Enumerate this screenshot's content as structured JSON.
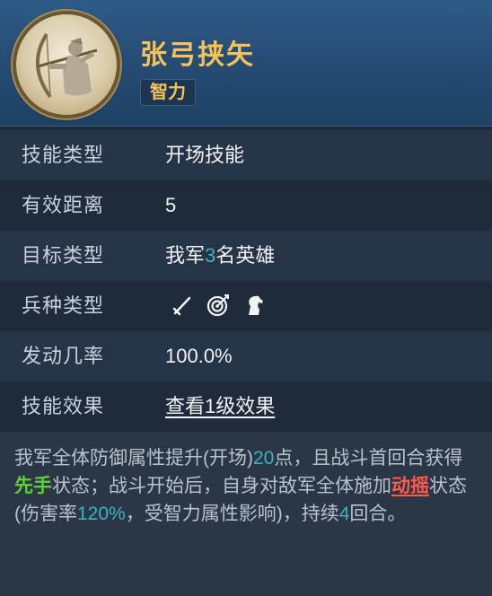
{
  "skill": {
    "name": "张弓挟矢",
    "attribute": "智力"
  },
  "rows": [
    {
      "label": "技能类型",
      "value": "开场技能"
    },
    {
      "label": "有效距离",
      "value": "5"
    },
    {
      "label": "目标类型",
      "value_prefix": "我军",
      "value_num": "3",
      "value_suffix": "名英雄"
    },
    {
      "label": "兵种类型",
      "icons": [
        "sword-icon",
        "target-icon",
        "horse-icon"
      ]
    },
    {
      "label": "发动几率",
      "value": "100.0%"
    },
    {
      "label": "技能效果",
      "link": "查看1级效果"
    }
  ],
  "description": {
    "p1": "我军全体防御属性提升(开场)",
    "n1": "20",
    "p2": "点，且战斗首回合获得",
    "kw1": "先手",
    "p3": "状态；战斗开始后，自身对敌军全体施加",
    "kw2": "动摇",
    "p4": "状态(伤害率",
    "n2": "120%",
    "p5": "，受智力属性影响)，持续",
    "n3": "4",
    "p6": "回合。"
  },
  "colors": {
    "title": "#f3c35a",
    "accent": "#38b6c0",
    "keyword_buff": "#5fd03c",
    "keyword_debuff": "#ff5a4a"
  }
}
